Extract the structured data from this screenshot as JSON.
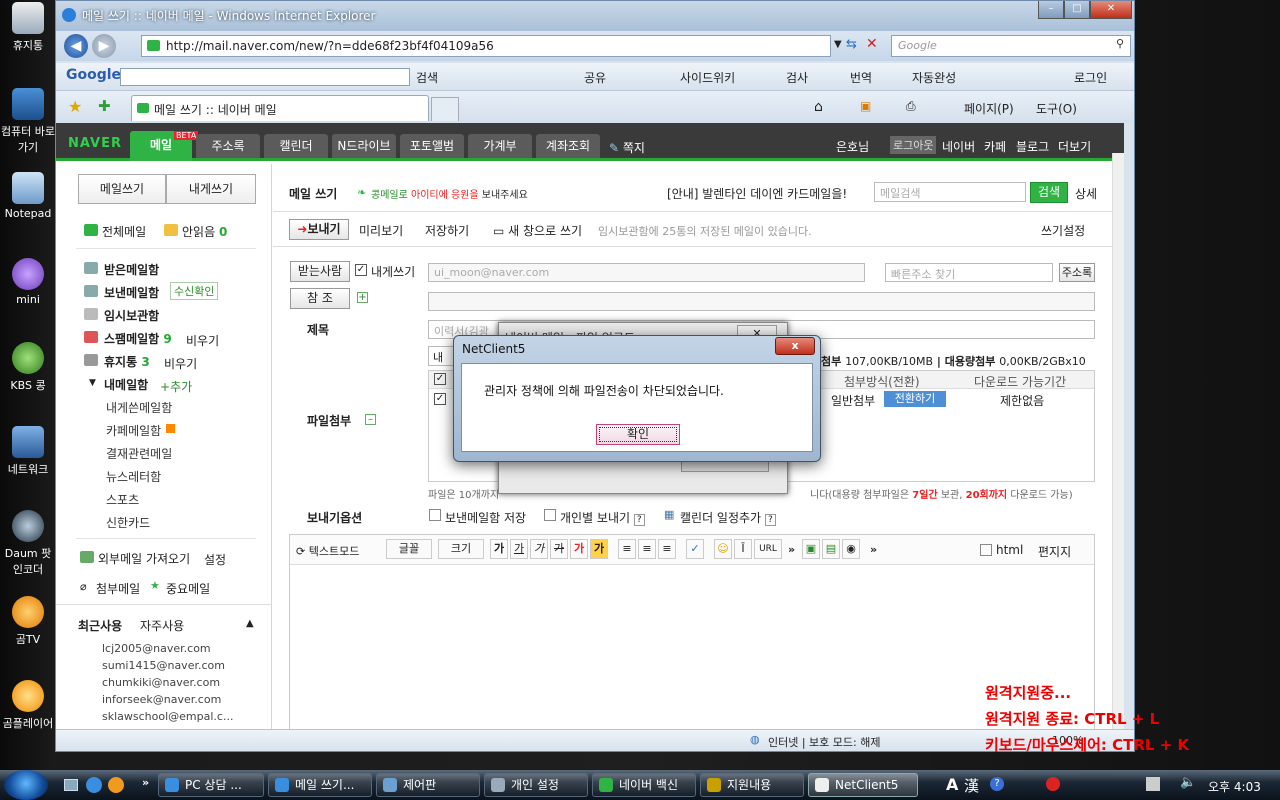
{
  "desktop": {
    "icons": [
      "휴지통",
      "컴퓨터 바로 가기",
      "Notepad",
      "mini",
      "KBS 콩",
      "네트워크",
      "Daum 팟인코더",
      "곰TV",
      "곰플레이어"
    ]
  },
  "browser": {
    "title": "메일 쓰기 :: 네이버 메일 - Windows Internet Explorer",
    "url": "http://mail.naver.com/new/?n=dde68f23bf4f04109a56",
    "search_placeholder": "Google",
    "tab_title": "메일 쓰기 :: 네이버 메일",
    "toolbar": {
      "google_logo": "Google",
      "search": "검색",
      "share": "공유",
      "sidewiki": "사이드위키",
      "check": "검사",
      "translate": "번역",
      "autofill": "자동완성",
      "login": "로그인",
      "page": "페이지(P)",
      "tools": "도구(O)"
    },
    "status": {
      "zone": "인터넷 | 보호 모드: 해제",
      "zoom": "100%"
    }
  },
  "naver": {
    "logo": "NAVER",
    "tabs": [
      "메일",
      "주소록",
      "캘린더",
      "N드라이브",
      "포토앨범",
      "가계부",
      "계좌조회"
    ],
    "beta": "BETA",
    "memo": "쪽지",
    "user": "은호님",
    "logout": "로그아웃",
    "links": [
      "네이버",
      "카페",
      "블로그",
      "더보기"
    ]
  },
  "sidebar": {
    "write_btn": "메일쓰기",
    "self_btn": "내게쓰기",
    "all_mail": "전체메일",
    "unread": "안읽음",
    "unread_count": "0",
    "inbox": "받은메일함",
    "sent": "보낸메일함",
    "read_check": "수신확인",
    "draft": "임시보관함",
    "spam": "스팸메일함",
    "spam_count": "9",
    "empty": "비우기",
    "trash": "휴지통",
    "trash_count": "3",
    "my": "내메일함",
    "add": "추가",
    "folders": [
      "내게쓴메일함",
      "카페메일함",
      "결재관련메일",
      "뉴스레터함",
      "스포츠",
      "신한카드"
    ],
    "external": "외부메일 가져오기",
    "settings": "설정",
    "attach": "첨부메일",
    "important": "중요메일",
    "recent_tab": "최근사용",
    "frequent_tab": "자주사용",
    "recent": [
      "lcj2005@naver.com",
      "sumi1415@naver.com",
      "chumkiki@naver.com",
      "inforseek@naver.com",
      "sklawschool@empal.c..."
    ]
  },
  "compose": {
    "title": "메일 쓰기",
    "promo_a": "콩메일로",
    "promo_b": "아이티에 응원을",
    "promo_c": "보내주세요",
    "notice": "[안내] 발렌타인 데이엔 카드메일을!",
    "search_placeholder": "메일검색",
    "search_btn": "검색",
    "detail": "상세",
    "send": "보내기",
    "preview": "미리보기",
    "save": "저장하기",
    "new_window": "새 창으로 쓰기",
    "draft_info": "임시보관함에 25통의 저장된 메일이 있습니다.",
    "write_settings": "쓰기설정",
    "to_btn": "받는사람",
    "self_check": "내게쓰기",
    "to_value": "ui_moon@naver.com",
    "quick_addr": "빠른주소 찾기",
    "addrbook": "주소록",
    "cc_btn": "참 조",
    "subject_label": "제목",
    "subject_value": "이력서(김광",
    "attach_label": "파일첨부",
    "attach_info_a": "첨부",
    "attach_info_b": "107,00KB/10MB",
    "attach_info_c": "대용량첨부",
    "attach_info_d": "0,00KB/2GBx10",
    "col_method": "첨부방식(전환)",
    "col_period": "다운로드 가능기간",
    "row_method": "일반첨부",
    "row_switch": "전환하기",
    "row_period": "제한없음",
    "attach_note_a": "파일은 10개까지",
    "attach_note_b": "니다(대용량 첨부파일은",
    "attach_note_days": "7일간",
    "attach_note_c": "보관,",
    "attach_note_count": "20회까지",
    "attach_note_d": "다운로드 가능)",
    "send_options": "보내기옵션",
    "opt1": "보낸메일함 저장",
    "opt2": "개인별 보내기",
    "opt3": "캘린더 일정추가",
    "textmode": "텍스트모드",
    "font": "글꼴",
    "size": "크기",
    "ga": "가",
    "url": "URL",
    "html": "html",
    "edit": "편지지"
  },
  "dialog_bg": {
    "title": "네이버 메일 - 파일 업로드"
  },
  "dialog": {
    "title": "NetClient5",
    "message": "관리자 정책에 의해 파일전송이 차단되었습니다.",
    "ok": "확인",
    "close": "x"
  },
  "remote": {
    "line1": "원격지원중...",
    "line2": "원격지원 종료: CTRL + L",
    "line3": "키보드/마우스제어: CTRL + K"
  },
  "taskbar": {
    "tasks": [
      "PC 상담 ...",
      "메일 쓰기...",
      "제어판",
      "개인 설정",
      "네이버 백신",
      "지원내용",
      "NetClient5"
    ],
    "clock": "오후 4:03",
    "ime": "漢"
  }
}
